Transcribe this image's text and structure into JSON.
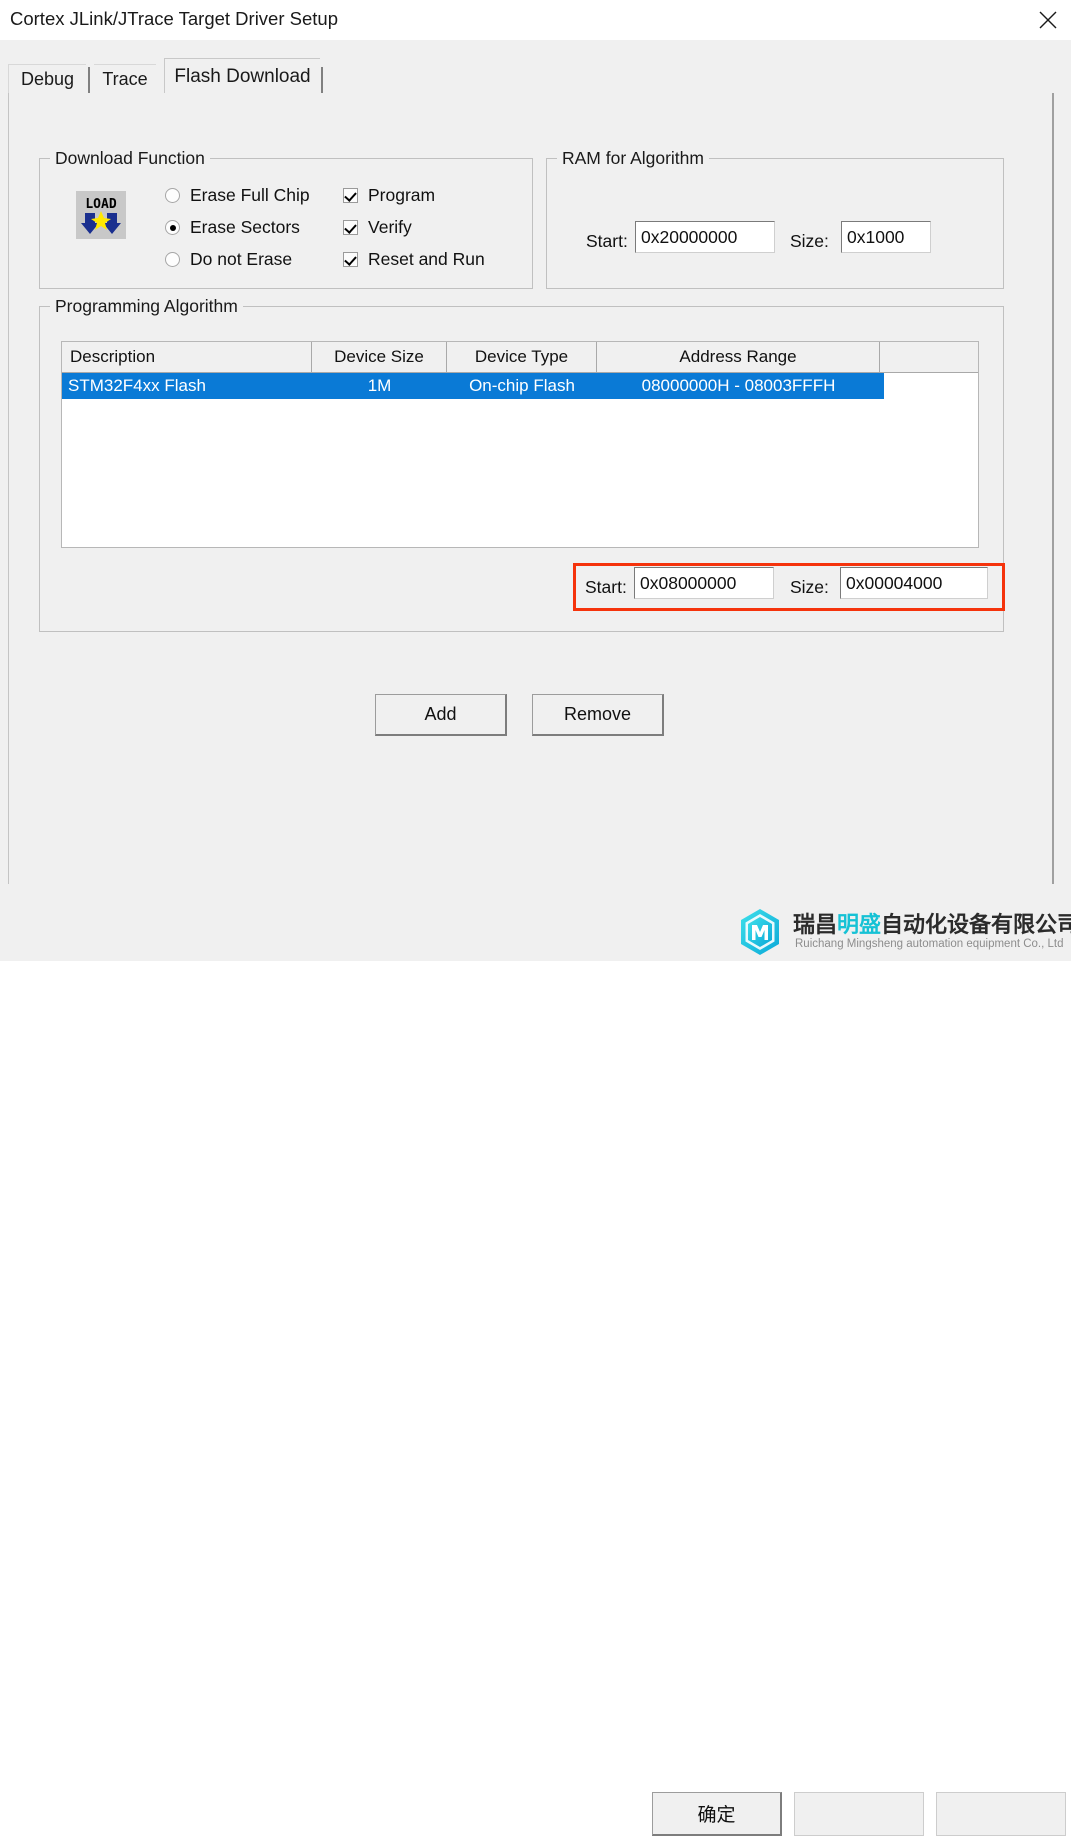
{
  "window": {
    "title": "Cortex JLink/JTrace Target Driver Setup",
    "close_icon": "close-icon"
  },
  "tabs": [
    {
      "label": "Debug",
      "active": false
    },
    {
      "label": "Trace",
      "active": false
    },
    {
      "label": "Flash Download",
      "active": true
    }
  ],
  "download_function": {
    "group_title": "Download Function",
    "icon": "load-icon",
    "radios": [
      {
        "label": "Erase Full Chip",
        "checked": false
      },
      {
        "label": "Erase Sectors",
        "checked": true
      },
      {
        "label": "Do not Erase",
        "checked": false
      }
    ],
    "checkboxes": [
      {
        "label": "Program",
        "checked": true
      },
      {
        "label": "Verify",
        "checked": true
      },
      {
        "label": "Reset and Run",
        "checked": true
      }
    ]
  },
  "ram_for_algorithm": {
    "group_title": "RAM for Algorithm",
    "start_label": "Start:",
    "start_value": "0x20000000",
    "size_label": "Size:",
    "size_value": "0x1000"
  },
  "programming_algorithm": {
    "group_title": "Programming Algorithm",
    "columns": [
      "Description",
      "Device Size",
      "Device Type",
      "Address Range",
      ""
    ],
    "rows": [
      {
        "description": "STM32F4xx Flash",
        "device_size": "1M",
        "device_type": "On-chip Flash",
        "address_range": "08000000H - 08003FFFH",
        "selected": true
      }
    ],
    "start_label": "Start:",
    "start_value": "0x08000000",
    "size_label": "Size:",
    "size_value": "0x00004000",
    "highlight_color": "#f5330c"
  },
  "buttons": {
    "add": "Add",
    "remove": "Remove",
    "ok": "确定"
  },
  "watermark": {
    "company_cn_part1": "瑞昌",
    "company_cn_highlight": "明盛",
    "company_cn_part2": "自动化设备有限公司",
    "company_en": "Ruichang Mingsheng automation equipment Co., Ltd",
    "logo_color": "#16c2d5"
  },
  "colors": {
    "selection_blue": "#0a7ad6",
    "dialog_bg": "#f0f0f0",
    "highlight_red": "#f5330c",
    "brand_cyan": "#16c2d5"
  }
}
